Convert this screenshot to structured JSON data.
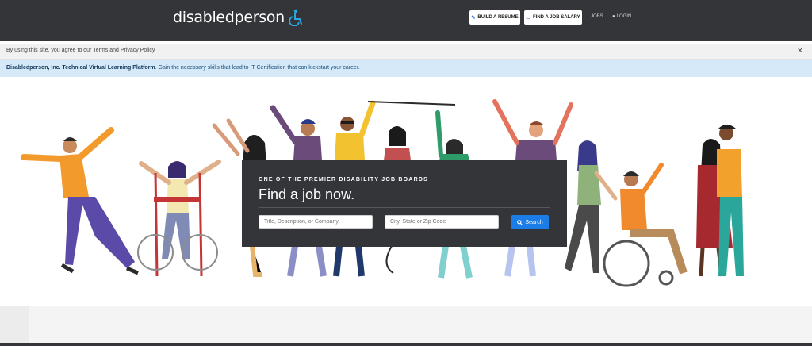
{
  "logo": {
    "text": "disabledperson",
    "icon": "wheelchair-icon",
    "color": "#2aa7df"
  },
  "nav": {
    "build_resume": "BUILD A RESUME",
    "job_salary": "FIND A JOB SALARY",
    "jobs": "JOBS",
    "login": "LOGIN",
    "accent": "#2a6fd6"
  },
  "cookie": {
    "text": "By using this site, you agree to our Terms and Privacy Policy",
    "close": "×"
  },
  "banner": {
    "bold": "Disabledperson, Inc. Technical Virtual Learning Platform",
    "text": ". Gain the necessary skills that lead to IT Certification that can kickstart your career."
  },
  "hero": {
    "kicker": "ONE OF THE PREMIER DISABILITY JOB BOARDS",
    "title": "Find a job now.",
    "keyword_placeholder": "Title, Description, or Company",
    "location_placeholder": "City, State or Zip Code",
    "search_label": "Search"
  }
}
